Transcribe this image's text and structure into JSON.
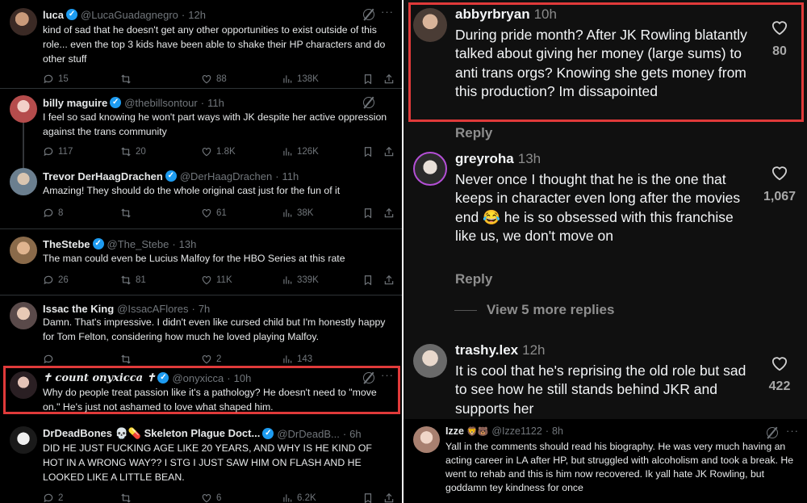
{
  "left_feed": {
    "tweets": [
      {
        "name": "luca",
        "verified": true,
        "handle": "@LucaGuadagnegro",
        "time": "12h",
        "text": "kind of sad that he doesn't get any other opportunities to exist outside of this role... even the top 3 kids have been able to shake their HP characters and do other stuff",
        "replies": "15",
        "retweets": "",
        "likes": "88",
        "views": "138K"
      },
      {
        "name": "billy maguire",
        "verified": true,
        "handle": "@thebillsontour",
        "time": "11h",
        "text": "I feel so sad knowing he won't part ways with JK despite her active oppression against the trans community",
        "replies": "117",
        "retweets": "20",
        "likes": "1.8K",
        "views": "126K"
      },
      {
        "name": "Trevor DerHaagDrachen",
        "verified": true,
        "handle": "@DerHaagDrachen",
        "time": "11h",
        "text": "Amazing! They should do the whole original cast just for the fun of it",
        "replies": "8",
        "retweets": "",
        "likes": "61",
        "views": "38K"
      },
      {
        "name": "TheStebe",
        "verified": true,
        "handle": "@The_Stebe",
        "time": "13h",
        "text": "The man could even be Lucius Malfoy for the HBO Series at this rate",
        "replies": "26",
        "retweets": "81",
        "likes": "11K",
        "views": "339K"
      },
      {
        "name": "Issac the King",
        "verified": false,
        "handle": "@IssacAFlores",
        "time": "7h",
        "text": "Damn. That's impressive. I didn't even like cursed child but I'm honestly happy for Tom Felton, considering how much he loved playing Malfoy.",
        "replies": "",
        "retweets": "",
        "likes": "2",
        "views": "143"
      },
      {
        "name": "✝ count onyxicca ✝",
        "verified": true,
        "handle": "@onyxicca",
        "time": "10h",
        "text": "Why do people treat passion like it's a pathology? He doesn't need to \"move on.\" He's just not ashamed to love what shaped him.",
        "replies": "",
        "retweets": "",
        "likes": "",
        "views": ""
      },
      {
        "name": "DrDeadBones 💀💊 Skeleton Plague Doct...",
        "verified": true,
        "handle": "@DrDeadB...",
        "time": "6h",
        "text": "DID HE JUST FUCKING AGE LIKE 20 YEARS, AND WHY IS HE KIND OF HOT IN A WRONG WAY?? I STG I JUST SAW HIM ON FLASH AND HE LOOKED LIKE A LITTLE BEAN.",
        "replies": "2",
        "retweets": "",
        "likes": "6",
        "views": "6.2K"
      }
    ]
  },
  "right_comments": {
    "comments": [
      {
        "username": "abbyrbryan",
        "time": "10h",
        "text": "During pride month? After JK Rowling blatantly talked about giving her money (large sums) to anti trans orgs? Knowing she gets money from this production? Im dissapointed",
        "likes": "80",
        "reply_label": "Reply"
      },
      {
        "username": "greyroha",
        "time": "13h",
        "text": "Never once I thought that he is the one that keeps in character even long after the movies end 😂 he is so obsessed with this franchise like us, we don't move on",
        "likes": "1,067",
        "reply_label": "Reply"
      },
      {
        "username": "trashy.lex",
        "time": "12h",
        "text": "It is cool that he's reprising the old role but sad to see how he still stands behind JKR and supports her",
        "likes": "422",
        "reply_label": ""
      }
    ],
    "view_more": "View 5 more replies"
  },
  "right_bottom_tweet": {
    "name": "Izze",
    "emoji": "🦁🐻",
    "handle": "@Izze1122",
    "time": "8h",
    "text": "Yall in the comments should read his biography. He was very much having an acting career in LA after HP, but struggled with alcoholism and took a break. He went to rehab and this is him now recovered. Ik yall hate JK Rowling, but goddamn tey kindness for once"
  },
  "colors": {
    "highlight_border": "#e03a3a",
    "x_background": "#000000",
    "threads_background": "#101010",
    "verified_blue": "#1d9bf0"
  }
}
